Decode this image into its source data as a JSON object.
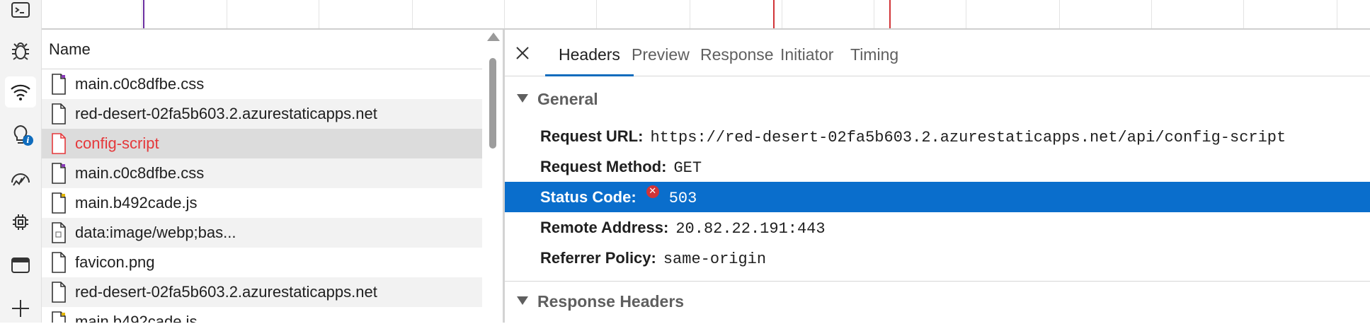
{
  "activity_bar": {
    "items": [
      {
        "icon": "console-icon",
        "active": false
      },
      {
        "icon": "bug-icon",
        "active": false
      },
      {
        "icon": "wifi-icon",
        "active": true
      },
      {
        "icon": "lightbulb-icon",
        "active": false,
        "badge": "i"
      },
      {
        "icon": "performance-icon",
        "active": false
      },
      {
        "icon": "chip-icon",
        "active": false
      },
      {
        "icon": "window-icon",
        "active": false
      },
      {
        "icon": "plus-icon",
        "active": false
      }
    ]
  },
  "request_list": {
    "column_header": "Name",
    "rows": [
      {
        "name": "main.c0c8dfbe.css",
        "type": "css",
        "state": "normal"
      },
      {
        "name": "red-desert-02fa5b603.2.azurestaticapps.net",
        "type": "doc",
        "state": "normal"
      },
      {
        "name": "config-script",
        "type": "doc",
        "state": "selected-error"
      },
      {
        "name": "main.c0c8dfbe.css",
        "type": "css",
        "state": "normal"
      },
      {
        "name": "main.b492cade.js",
        "type": "js",
        "state": "normal"
      },
      {
        "name": "data:image/webp;bas...",
        "type": "img",
        "state": "normal"
      },
      {
        "name": "favicon.png",
        "type": "doc",
        "state": "normal"
      },
      {
        "name": "red-desert-02fa5b603.2.azurestaticapps.net",
        "type": "doc",
        "state": "normal"
      },
      {
        "name": "main.b492cade.js",
        "type": "js",
        "state": "normal"
      }
    ]
  },
  "details": {
    "tabs": [
      "Headers",
      "Preview",
      "Response",
      "Initiator",
      "Timing"
    ],
    "active_tab": "Headers",
    "general": {
      "title": "General",
      "request_url_label": "Request URL:",
      "request_url": "https://red-desert-02fa5b603.2.azurestaticapps.net/api/config-script",
      "request_method_label": "Request Method:",
      "request_method": "GET",
      "status_code_label": "Status Code:",
      "status_code": "503",
      "remote_address_label": "Remote Address:",
      "remote_address": "20.82.22.191:443",
      "referrer_policy_label": "Referrer Policy:",
      "referrer_policy": "same-origin"
    },
    "response_headers_title": "Response Headers"
  },
  "colors": {
    "accent": "#0f6cbd",
    "status_highlight": "#0a6ecc",
    "error_text": "#e5383b",
    "error_badge": "#d13438",
    "timeline_purple": "#6b2fa0",
    "timeline_red": "#d13438"
  }
}
